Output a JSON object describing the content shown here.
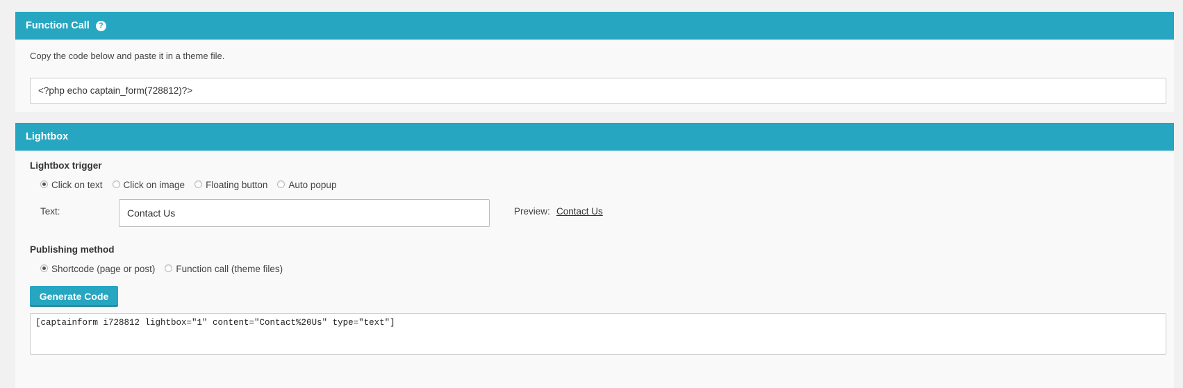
{
  "function_call": {
    "title": "Function Call",
    "help_icon": "question-mark-icon",
    "description": "Copy the code below and paste it in a theme file.",
    "code": "<?php echo captain_form(728812)?>"
  },
  "lightbox": {
    "title": "Lightbox",
    "trigger_label": "Lightbox trigger",
    "trigger_options": [
      {
        "label": "Click on text",
        "checked": true
      },
      {
        "label": "Click on image",
        "checked": false
      },
      {
        "label": "Floating button",
        "checked": false
      },
      {
        "label": "Auto popup",
        "checked": false
      }
    ],
    "text_label": "Text:",
    "text_value": "Contact Us",
    "preview_label": "Preview:",
    "preview_link": "Contact Us",
    "publishing_label": "Publishing method",
    "publishing_options": [
      {
        "label": "Shortcode (page or post)",
        "checked": true
      },
      {
        "label": "Function call (theme files)",
        "checked": false
      }
    ],
    "generate_button": "Generate Code",
    "generated_code": "[captainform i728812 lightbox=\"1\" content=\"Contact%20Us\" type=\"text\"]"
  },
  "colors": {
    "header_bg": "#26a6c1",
    "panel_bg": "#f9f9f9",
    "page_bg": "#f1f1f1"
  }
}
